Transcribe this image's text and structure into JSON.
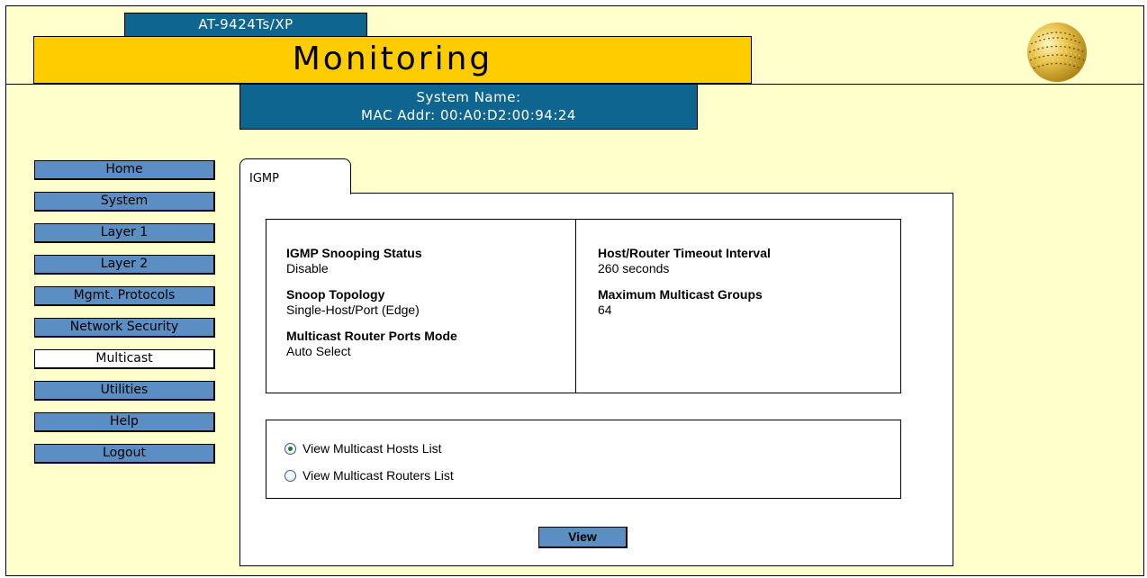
{
  "header": {
    "model": "AT-9424Ts/XP",
    "title": "Monitoring",
    "system_name": "System Name:",
    "mac_addr": "MAC Addr: 00:A0:D2:00:94:24"
  },
  "nav": {
    "items": [
      {
        "label": "Home"
      },
      {
        "label": "System"
      },
      {
        "label": "Layer 1"
      },
      {
        "label": "Layer 2"
      },
      {
        "label": "Mgmt. Protocols"
      },
      {
        "label": "Network Security"
      },
      {
        "label": "Multicast",
        "active": true
      },
      {
        "label": "Utilities"
      },
      {
        "label": "Help"
      },
      {
        "label": "Logout"
      }
    ]
  },
  "tab": {
    "label": "IGMP"
  },
  "info": {
    "snooping_status": {
      "label": "IGMP Snooping Status",
      "value": "Disable"
    },
    "snoop_topology": {
      "label": "Snoop Topology",
      "value": "Single-Host/Port (Edge)"
    },
    "router_ports_mode": {
      "label": "Multicast Router Ports Mode",
      "value": "Auto Select"
    },
    "timeout_interval": {
      "label": "Host/Router Timeout Interval",
      "value": "260 seconds"
    },
    "max_groups": {
      "label": "Maximum Multicast Groups",
      "value": "64"
    }
  },
  "options": {
    "hosts": {
      "label": "View Multicast Hosts List",
      "checked": true
    },
    "routers": {
      "label": "View Multicast Routers List",
      "checked": false
    }
  },
  "actions": {
    "view_label": "View"
  },
  "colors": {
    "background": "#ffffcc",
    "title_bar": "#ffcc00",
    "header_blue": "#0e6590",
    "nav_button": "#5b8ec2"
  }
}
